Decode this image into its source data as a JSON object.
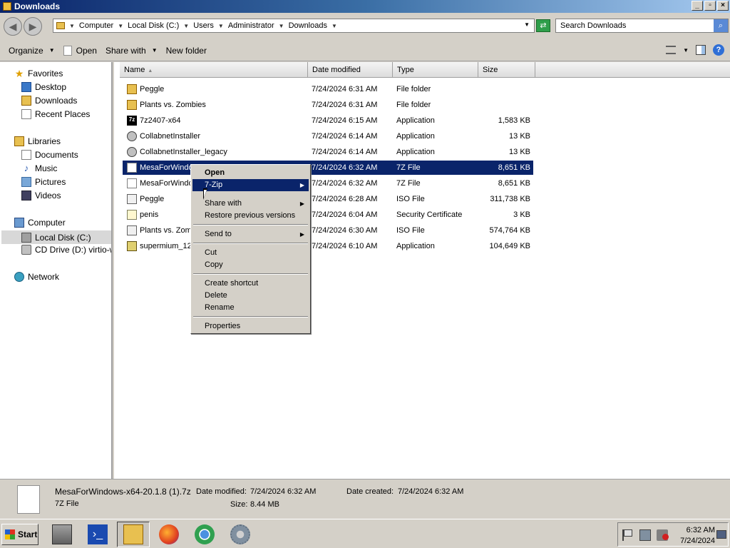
{
  "window": {
    "title": "Downloads"
  },
  "address": {
    "crumbs": [
      "Computer",
      "Local Disk (C:)",
      "Users",
      "Administrator",
      "Downloads"
    ],
    "search_placeholder": "Search Downloads"
  },
  "toolbar": {
    "organize": "Organize",
    "open": "Open",
    "share_with": "Share with",
    "new_folder": "New folder"
  },
  "nav": {
    "favorites": "Favorites",
    "desktop": "Desktop",
    "downloads": "Downloads",
    "recent_places": "Recent Places",
    "libraries": "Libraries",
    "documents": "Documents",
    "music": "Music",
    "pictures": "Pictures",
    "videos": "Videos",
    "computer": "Computer",
    "local_disk": "Local Disk (C:)",
    "cd_drive": "CD Drive (D:) virtio-win",
    "network": "Network"
  },
  "columns": {
    "name": "Name",
    "date": "Date modified",
    "type": "Type",
    "size": "Size"
  },
  "files": [
    {
      "name": "Peggle",
      "date": "7/24/2024 6:31 AM",
      "type": "File folder",
      "size": "",
      "icon": "folder-icon"
    },
    {
      "name": "Plants vs. Zombies",
      "date": "7/24/2024 6:31 AM",
      "type": "File folder",
      "size": "",
      "icon": "folder-icon"
    },
    {
      "name": "7z2407-x64",
      "date": "7/24/2024 6:15 AM",
      "type": "Application",
      "size": "1,583 KB",
      "icon": "7zip-icon"
    },
    {
      "name": "CollabnetInstaller",
      "date": "7/24/2024 6:14 AM",
      "type": "Application",
      "size": "13 KB",
      "icon": "installer-icon"
    },
    {
      "name": "CollabnetInstaller_legacy",
      "date": "7/24/2024 6:14 AM",
      "type": "Application",
      "size": "13 KB",
      "icon": "installer-icon"
    },
    {
      "name": "MesaForWindo",
      "date": "7/24/2024 6:32 AM",
      "type": "7Z File",
      "size": "8,651 KB",
      "icon": "file-icon",
      "selected": true
    },
    {
      "name": "MesaForWindo",
      "date": "7/24/2024 6:32 AM",
      "type": "7Z File",
      "size": "8,651 KB",
      "icon": "file-icon"
    },
    {
      "name": "Peggle",
      "date": "7/24/2024 6:28 AM",
      "type": "ISO File",
      "size": "311,738 KB",
      "icon": "iso-icon"
    },
    {
      "name": "penis",
      "date": "7/24/2024 6:04 AM",
      "type": "Security Certificate",
      "size": "3 KB",
      "icon": "certificate-icon"
    },
    {
      "name": "Plants vs. Zom",
      "date": "7/24/2024 6:30 AM",
      "type": "ISO File",
      "size": "574,764 KB",
      "icon": "iso-icon"
    },
    {
      "name": "supermium_12",
      "date": "7/24/2024 6:10 AM",
      "type": "Application",
      "size": "104,649 KB",
      "icon": "app-icon"
    }
  ],
  "context_menu": {
    "open": "Open",
    "seven_zip": "7-Zip",
    "share_with": "Share with",
    "restore": "Restore previous versions",
    "send_to": "Send to",
    "cut": "Cut",
    "copy": "Copy",
    "create_shortcut": "Create shortcut",
    "delete": "Delete",
    "rename": "Rename",
    "properties": "Properties"
  },
  "details": {
    "name": "MesaForWindows-x64-20.1.8 (1).7z",
    "type": "7Z File",
    "date_modified_label": "Date modified:",
    "date_modified": "7/24/2024 6:32 AM",
    "size_label": "Size:",
    "size": "8.44 MB",
    "date_created_label": "Date created:",
    "date_created": "7/24/2024 6:32 AM"
  },
  "taskbar": {
    "start": "Start",
    "time": "6:32 AM",
    "date": "7/24/2024"
  }
}
